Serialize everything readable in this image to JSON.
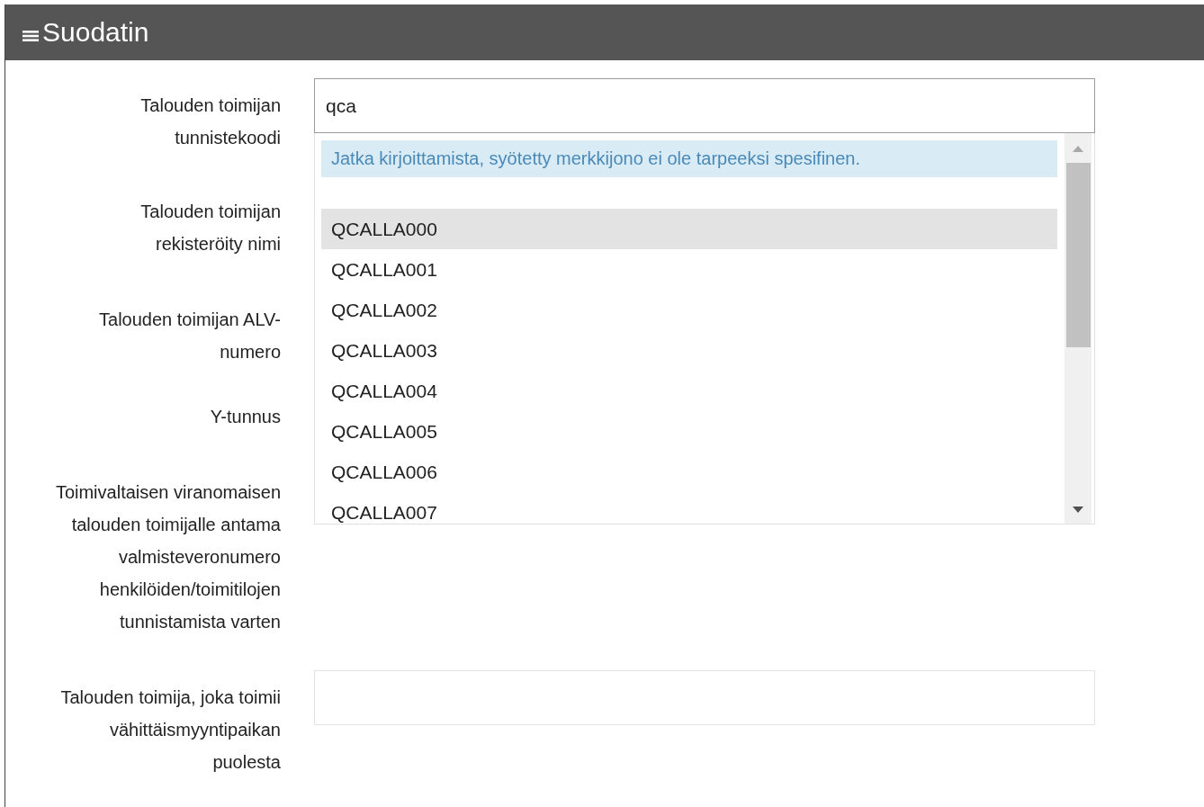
{
  "header": {
    "title": "Suodatin"
  },
  "fields": [
    {
      "label": "Talouden toimijan tunnistekoodi",
      "kind": "input",
      "value": "qca"
    },
    {
      "label": "Talouden toimijan rekisteröity nimi",
      "kind": "label-only"
    },
    {
      "label": "Talouden toimijan ALV-numero",
      "kind": "label-only"
    },
    {
      "label": "Y-tunnus",
      "kind": "label-only"
    },
    {
      "label": "Toimivaltaisen viranomaisen talouden toimijalle antama valmisteveronumero henkilöiden/toimitilojen tunnistamista varten",
      "kind": "label-only"
    },
    {
      "label": "Talouden toimija, joka toimii vähittäismyyntipaikan puolesta",
      "kind": "input"
    }
  ],
  "dropdown": {
    "notice": "Jatka kirjoittamista, syötetty merkkijono ei ole tarpeeksi spesifinen.",
    "items": [
      {
        "text": "QCALLA000",
        "selected": true
      },
      {
        "text": "QCALLA001",
        "selected": false
      },
      {
        "text": "QCALLA002",
        "selected": false
      },
      {
        "text": "QCALLA003",
        "selected": false
      },
      {
        "text": "QCALLA004",
        "selected": false
      },
      {
        "text": "QCALLA005",
        "selected": false
      },
      {
        "text": "QCALLA006",
        "selected": false
      },
      {
        "text": "QCALLA007",
        "selected": false
      }
    ]
  }
}
